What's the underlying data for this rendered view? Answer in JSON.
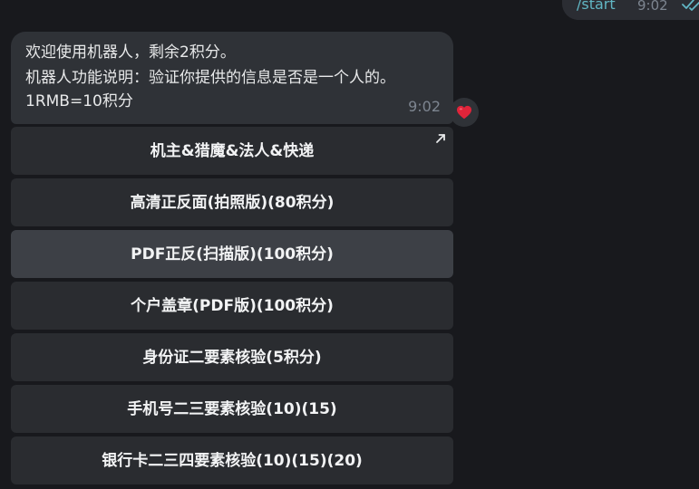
{
  "outgoing_message": {
    "text": "/start",
    "time": "9:02",
    "status_icon": "double-check-icon",
    "accent_color": "#61b6c4"
  },
  "bot_message": {
    "lines": [
      "欢迎使用机器人，剩余2积分。",
      "机器人功能说明：验证你提供的信息是否是一个人的。",
      "1RMB=10积分"
    ],
    "time": "9:02",
    "reaction_icon": "red-heart-icon",
    "reaction_color": "#e0243a"
  },
  "inline_keyboard": [
    {
      "label": "机主&猎魔&法人&快递",
      "icon": "external-link-arrow-icon"
    },
    {
      "label": "高清正反面(拍照版)(80积分)"
    },
    {
      "label": "PDF正反(扫描版)(100积分)"
    },
    {
      "label": "个户盖章(PDF版)(100积分)"
    },
    {
      "label": "身份证二要素核验(5积分)"
    },
    {
      "label": "手机号二三要素核验(10)(15)"
    },
    {
      "label": "银行卡二三四要素核验(10)(15)(20)"
    }
  ]
}
